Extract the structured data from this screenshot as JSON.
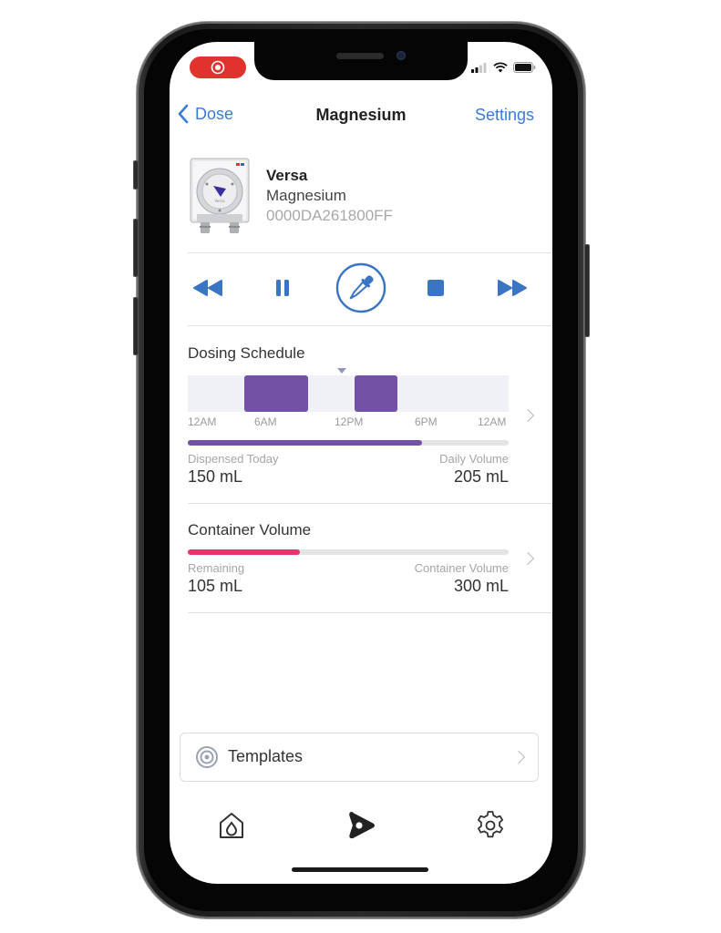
{
  "status_bar": {
    "recording_indicator": "screen-recording",
    "icons": [
      "cellular-signal-icon",
      "wifi-icon",
      "battery-icon"
    ]
  },
  "nav": {
    "back_label": "Dose",
    "title": "Magnesium",
    "settings_label": "Settings"
  },
  "device": {
    "name": "Versa",
    "additive": "Magnesium",
    "serial": "0000DA261800FF"
  },
  "controls": {
    "items": [
      "rewind-icon",
      "pause-icon",
      "dropper-icon",
      "stop-icon",
      "fast-forward-icon"
    ],
    "accent_color": "#3a7bd5"
  },
  "dosing_schedule": {
    "title": "Dosing Schedule",
    "time_labels": [
      "12AM",
      "6AM",
      "12PM",
      "6PM",
      "12AM"
    ],
    "dose_windows_hours": [
      {
        "start": 4.2,
        "end": 9.0
      },
      {
        "start": 12.5,
        "end": 15.7
      }
    ],
    "current_time_hours": 11.5,
    "block_color": "#7352a6",
    "dispensed_label": "Dispensed Today",
    "dispensed_value": "150 mL",
    "daily_label": "Daily Volume",
    "daily_value": "205 mL",
    "progress_fraction": 0.73,
    "progress_color": "#7352a6"
  },
  "container": {
    "title": "Container Volume",
    "remaining_label": "Remaining",
    "remaining_value": "105 mL",
    "capacity_label": "Container Volume",
    "capacity_value": "300 mL",
    "progress_fraction": 0.35,
    "progress_color": "#e8336d"
  },
  "templates": {
    "label": "Templates"
  },
  "tabbar": {
    "items": [
      "home-drop-icon",
      "dosing-pump-icon",
      "settings-gear-icon"
    ],
    "active_index": 1
  }
}
